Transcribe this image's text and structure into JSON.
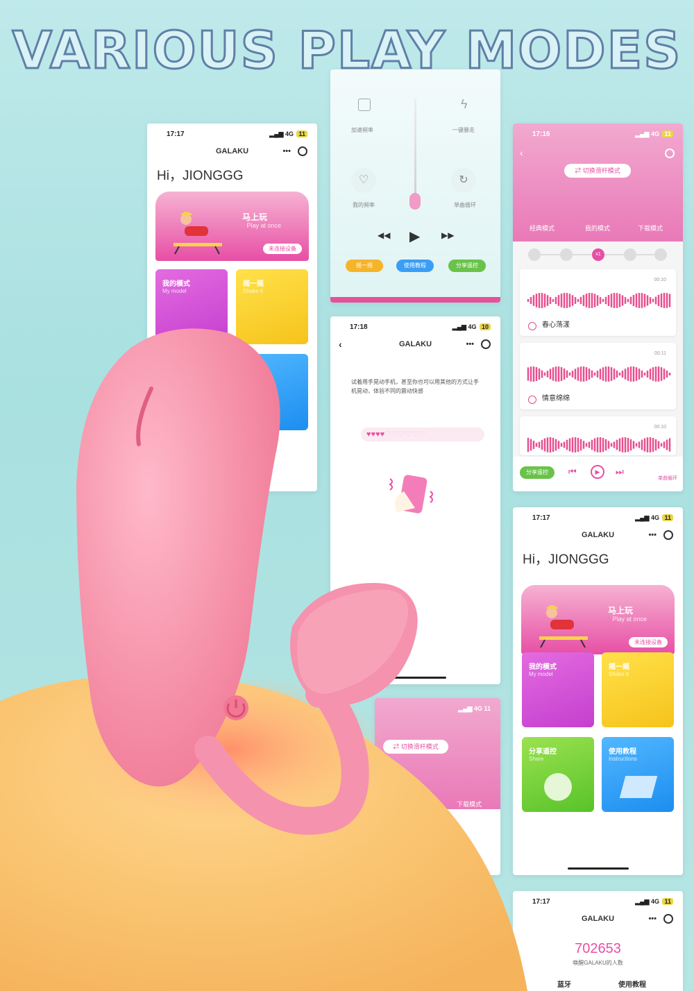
{
  "headline": "VARIOUS PLAY MODES",
  "brand": "GALAKU",
  "status": {
    "time1": "17:17",
    "time2": "17:18",
    "time3": "17:16",
    "signal": "4G",
    "batt1": "11",
    "batt2": "10"
  },
  "home": {
    "greeting": "Hi，JIONGGG",
    "banner_cn": "马上玩",
    "banner_en": "Play at once",
    "banner_pill": "未连接设备",
    "tiles": [
      {
        "cn": "我的模式",
        "en": "My model"
      },
      {
        "cn": "摇一摇",
        "en": "Shake it"
      },
      {
        "cn": "分享遥控",
        "en": "Share"
      },
      {
        "cn": "使用教程",
        "en": "Instructions"
      }
    ],
    "partial_tile_cn": "使用教程"
  },
  "control": {
    "top_left": "加速频率",
    "top_right": "一键暴走",
    "mid_left": "我的频率",
    "mid_right": "单曲循环",
    "buttons": [
      "摇一摇",
      "使用教程",
      "分享遥控"
    ],
    "colors": {
      "orange": "#f6b42a",
      "blue": "#3b9ef5",
      "green": "#69c34a"
    }
  },
  "shake": {
    "instruction": "试着用手晃动手机，甚至你也可以用其他的方式让手机晃动，体验不同的震动快感"
  },
  "music": {
    "switch_label": "⇄ 切换滑杆模式",
    "tabs": [
      "经典模式",
      "我的模式",
      "下载模式"
    ],
    "speed_selected": "x1",
    "tracks": [
      {
        "name": "春心荡漾",
        "duration": "00:10"
      },
      {
        "name": "情意绵绵",
        "duration": "00:11"
      },
      {
        "name": "",
        "duration": "00:10"
      }
    ],
    "share_btn": "分享遥控",
    "loop_label": "单曲循环"
  },
  "code": {
    "value": "702653",
    "caption": "唤醒GALAKU的人数",
    "links": [
      "蓝牙",
      "使用教程"
    ]
  },
  "switch2": {
    "label": "⇄ 切换滑杆模式",
    "tab": "下载模式"
  },
  "accent": "#e74fa5"
}
